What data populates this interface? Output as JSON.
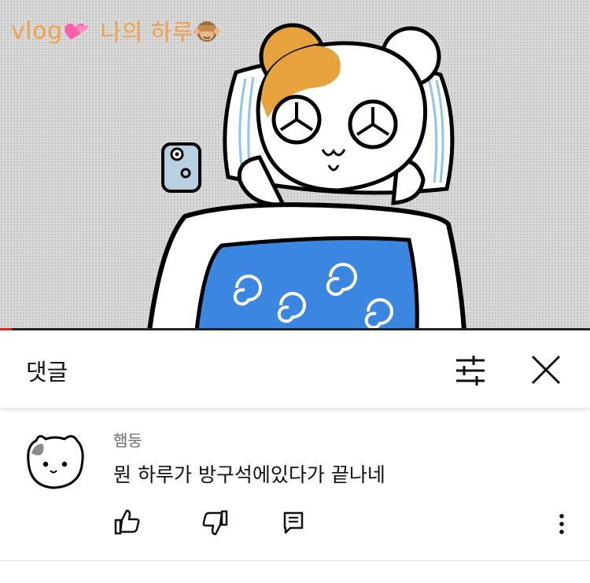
{
  "video": {
    "title_vlog": "vlog",
    "title_text": "나의 하루",
    "progress_fraction": 0.02,
    "colors": {
      "title": "#f0a24a",
      "progress": "#e62117",
      "blanket": "#3a86e0",
      "hamster_patch": "#e8a23c"
    }
  },
  "comments": {
    "header_title": "댓글",
    "sort_icon": "sliders-icon",
    "close_icon": "close-icon"
  },
  "comment": {
    "author": "햄둥",
    "text": "뭔 하루가 방구석에있다가 끝나네",
    "actions": [
      "thumbs-up-icon",
      "thumbs-down-icon",
      "reply-icon",
      "more-vert-icon"
    ]
  }
}
